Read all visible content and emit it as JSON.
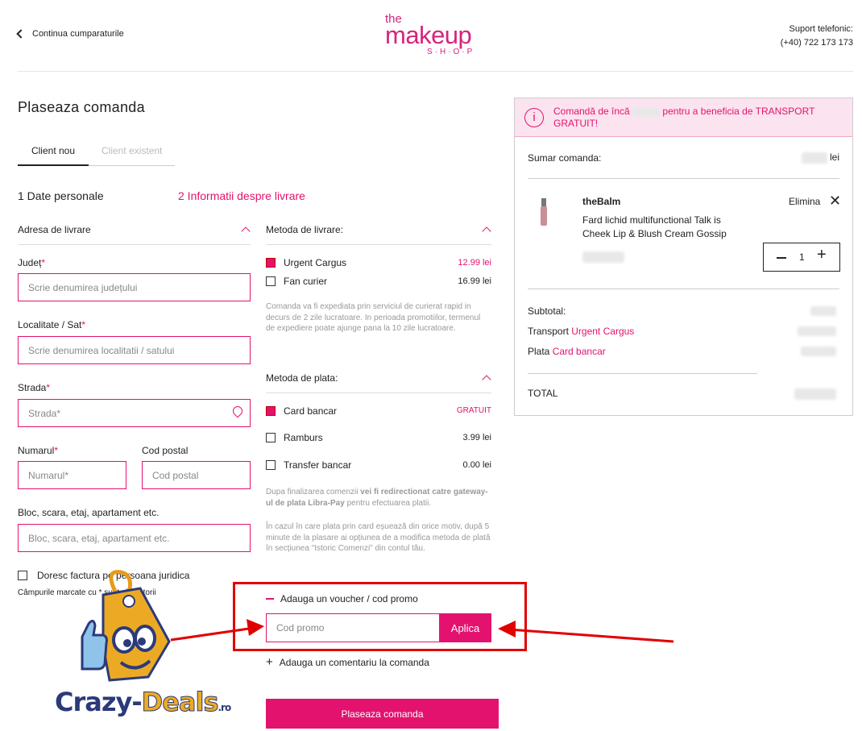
{
  "header": {
    "back_label": "Continua cumparaturile",
    "logo": {
      "the": "the",
      "makeup": "makeup",
      "shop": "S·H·O·P"
    },
    "support_label": "Suport telefonic:",
    "support_phone": "(+40) 722 173 173"
  },
  "checkout": {
    "title": "Plaseaza comanda",
    "tabs": [
      "Client nou",
      "Client existent"
    ],
    "steps": [
      "1 Date personale",
      "2 Informatii despre livrare"
    ],
    "address": {
      "heading": "Adresa de livrare",
      "judet_label": "Județ",
      "judet_placeholder": "Scrie denumirea județului",
      "localitate_label": "Localitate / Sat",
      "localitate_placeholder": "Scrie denumirea localitatii / satului",
      "strada_label": "Strada",
      "strada_placeholder": "Strada*",
      "numarul_label": "Numarul",
      "numarul_placeholder": "Numarul*",
      "codpostal_label": "Cod postal",
      "codpostal_placeholder": "Cod postal",
      "bloc_label": "Bloc, scara, etaj, apartament etc.",
      "bloc_placeholder": "Bloc, scara, etaj, apartament etc.",
      "required_mark": "*",
      "invoice_label": "Doresc factura pe persoana juridica",
      "required_note": "Câmpurile marcate cu * sunt obligatorii"
    },
    "delivery": {
      "heading": "Metoda de livrare:",
      "options": [
        {
          "label": "Urgent Cargus",
          "price": "12.99 lei",
          "checked": true
        },
        {
          "label": "Fan curier",
          "price": "16.99 lei",
          "checked": false
        }
      ],
      "note": "Comanda va fi expediata prin serviciul de curierat rapid in decurs de 2 zile lucratoare. In perioada promotiilor, termenul de expediere poate ajunge pana la 10 zile lucratoare."
    },
    "payment": {
      "heading": "Metoda de plata:",
      "options": [
        {
          "label": "Card bancar",
          "price": "GRATUIT",
          "checked": true
        },
        {
          "label": "Ramburs",
          "price": "3.99 lei",
          "checked": false
        },
        {
          "label": "Transfer bancar",
          "price": "0.00 lei",
          "checked": false
        }
      ],
      "note1_a": "Dupa finalizarea comenzii ",
      "note1_b": "vei fi redirectionat catre gateway-ul de plata Libra-Pay",
      "note1_c": " pentru efectuarea platii.",
      "note2": "În cazul în care plata prin card eșuează din orice motiv, după 5 minute de la plasare ai opțiunea de a modifica metoda de plată în secțiunea \"Istoric Comenzi\" din contul tău."
    },
    "voucher": {
      "toggle_label": "Adauga un voucher / cod promo",
      "input_placeholder": "Cod promo",
      "apply_label": "Aplica"
    },
    "comment_label": "Adauga un comentariu la comanda",
    "place_order_label": "Plaseaza comanda"
  },
  "summary": {
    "banner_before": "Comandă de încă",
    "banner_after": "pentru a beneficia de TRANSPORT GRATUIT!",
    "heading": "Sumar comanda:",
    "currency": "lei",
    "item": {
      "brand": "theBalm",
      "name": "Fard lichid multifunctional Talk is Cheek Lip & Blush Cream Gossip",
      "remove_label": "Elimina",
      "quantity": "1"
    },
    "rows": {
      "subtotal": "Subtotal:",
      "transport_label": "Transport",
      "transport_method": "Urgent Cargus",
      "plata_label": "Plata",
      "plata_method": "Card bancar",
      "total": "TOTAL"
    }
  },
  "watermark": {
    "brand_part1": "Crazy-",
    "brand_part2": "Deals",
    "brand_suffix": ".ro"
  },
  "colors": {
    "accent": "#e3126f",
    "annotation_red": "#e10000",
    "banner_bg": "#fbe4ef"
  }
}
